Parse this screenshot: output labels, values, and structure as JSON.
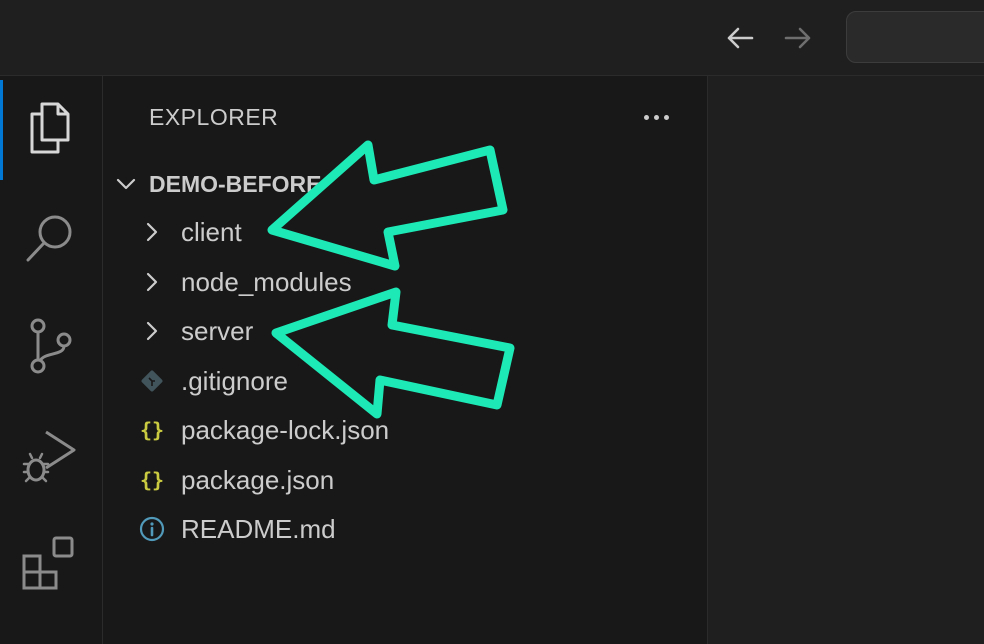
{
  "titlebar": {
    "back_icon": "arrow-left-icon",
    "forward_icon": "arrow-right-icon",
    "command_center_placeholder": ""
  },
  "activitybar": {
    "items": [
      {
        "icon": "files-icon",
        "active": true
      },
      {
        "icon": "search-icon",
        "active": false
      },
      {
        "icon": "source-control-icon",
        "active": false
      },
      {
        "icon": "run-debug-icon",
        "active": false
      },
      {
        "icon": "extensions-icon",
        "active": false
      }
    ],
    "accent_color": "#0078d4"
  },
  "sidebar": {
    "title": "EXPLORER",
    "more_icon": "ellipsis-icon",
    "root_folder": "DEMO-BEFORE",
    "items": [
      {
        "name": "client",
        "type": "folder",
        "icon": "chevron-right-icon"
      },
      {
        "name": "node_modules",
        "type": "folder",
        "icon": "chevron-right-icon"
      },
      {
        "name": "server",
        "type": "folder",
        "icon": "chevron-right-icon"
      },
      {
        "name": ".gitignore",
        "type": "file",
        "icon": "git-icon"
      },
      {
        "name": "package-lock.json",
        "type": "file",
        "icon": "json-icon"
      },
      {
        "name": "package.json",
        "type": "file",
        "icon": "json-icon"
      },
      {
        "name": "README.md",
        "type": "file",
        "icon": "info-icon"
      }
    ]
  },
  "annotations": {
    "arrow_color": "#1de9b6",
    "targets": [
      "client",
      "server"
    ]
  }
}
